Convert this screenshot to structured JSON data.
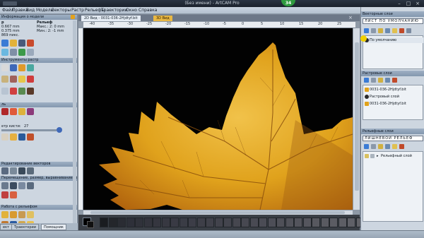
{
  "app": {
    "window_title": "(Без имени) - ArtCAM Pro",
    "badge": "34"
  },
  "menu": [
    "Файл",
    "Правка",
    "Вид",
    "Модель",
    "Векторы",
    "Растр",
    "Рельефы",
    "Траектории",
    "Окно",
    "Справка"
  ],
  "left_panel": {
    "model_info_header": "Информация о модели",
    "col_size": "р",
    "col_relief": "Рельеф",
    "size_lines": [
      "0.667 mm",
      "0.375 mm",
      "869 пикс."
    ],
    "relief_lines": [
      "Макс.: 2: 0 mm",
      "Мин.: 2: -1 mm"
    ],
    "raster_tools_header": "Инструменты растр",
    "brush_header": "ль",
    "brush_diameter_label": "етр кисти:",
    "brush_diameter_value": "27",
    "vector_edit_header": "Редактирование векторов",
    "vector_transform_header": "Перемещение, размер, выравнивание векто",
    "relief_tools_header": "Работа с рельефом",
    "tabs": [
      "ект",
      "Траектории",
      "Помощник"
    ]
  },
  "document": {
    "tab_2d": "2D Вид - 0031-036-2Hjdtyf.bit",
    "tab_3d": "3D Вид",
    "ruler_ticks": [
      "-40",
      "-35",
      "-30",
      "-25",
      "-20",
      "-15",
      "-10",
      "-5",
      "0",
      "5",
      "10",
      "15",
      "20",
      "25"
    ]
  },
  "right_panel": {
    "vector_layers_header": "Векторные слои",
    "vector_sheet": "ЛИСТ ПО УМОЛЧАНИЮ",
    "vector_layers": [
      "По умолчанию"
    ],
    "raster_layers_header": "Растровые слои",
    "raster_layers": [
      "0031-036-2Hjdtyf.bit",
      "Растровый слой",
      "0031-036-2Hjdtyf.bit"
    ],
    "relief_layers_header": "Рельефные слои",
    "relief_sheet": "ЛИШНЕВОЙ РЕЛЬЕФ",
    "relief_layers": [
      "Рельефный слой"
    ]
  },
  "colors": {
    "accent_tab": "#e9b843",
    "canvas_bg": "#020202",
    "leaf_gold": "#e0a21c",
    "panel_bg": "#cdd6e0",
    "section_header": "#8fa2b8"
  },
  "palette_colors": [
    "#1a1c20",
    "#24262b",
    "#2a2c33",
    "#2e3039",
    "#30323a",
    "#33343d",
    "#35363f",
    "#373841",
    "#393a44",
    "#3a3c45",
    "#3c3d47",
    "#3e3f48",
    "#40414a",
    "#42434c",
    "#44454e",
    "#46474f",
    "#474851",
    "#494a53",
    "#4b4c55",
    "#4d4e57",
    "#4f5058",
    "#51525a",
    "#53545c",
    "#55565e",
    "#57585f",
    "#595a61",
    "#5b5c63",
    "#5d5e65",
    "#5f6067",
    "#616268"
  ]
}
